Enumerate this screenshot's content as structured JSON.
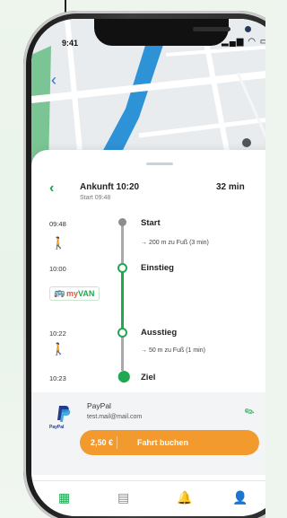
{
  "status_bar": {
    "time": "9:41"
  },
  "header": {
    "title": "Ankunft 10:20",
    "subtitle": "Start 09:48",
    "duration": "32 min"
  },
  "timeline": {
    "start_time": "09:48",
    "start_label": "Start",
    "walk_1": "→ 200 m zu Fuß (3 min)",
    "boarding_time": "10:00",
    "boarding_label": "Einstieg",
    "exit_time": "10:22",
    "exit_label": "Ausstieg",
    "walk_2": "→ 50 m zu Fuß (1 min)",
    "goal_time": "10:23",
    "goal_label": "Ziel"
  },
  "vehicle": {
    "brand_prefix": "my",
    "brand_name": "VAN"
  },
  "payment": {
    "method": "PayPal",
    "email": "test.mail@mail.com",
    "logo_caption": "PayPal"
  },
  "booking": {
    "price": "2,50 €",
    "action": "Fahrt buchen"
  },
  "colors": {
    "accent": "#1ea84f",
    "booking": "#f29a2e",
    "paypal": "#243a8f"
  }
}
